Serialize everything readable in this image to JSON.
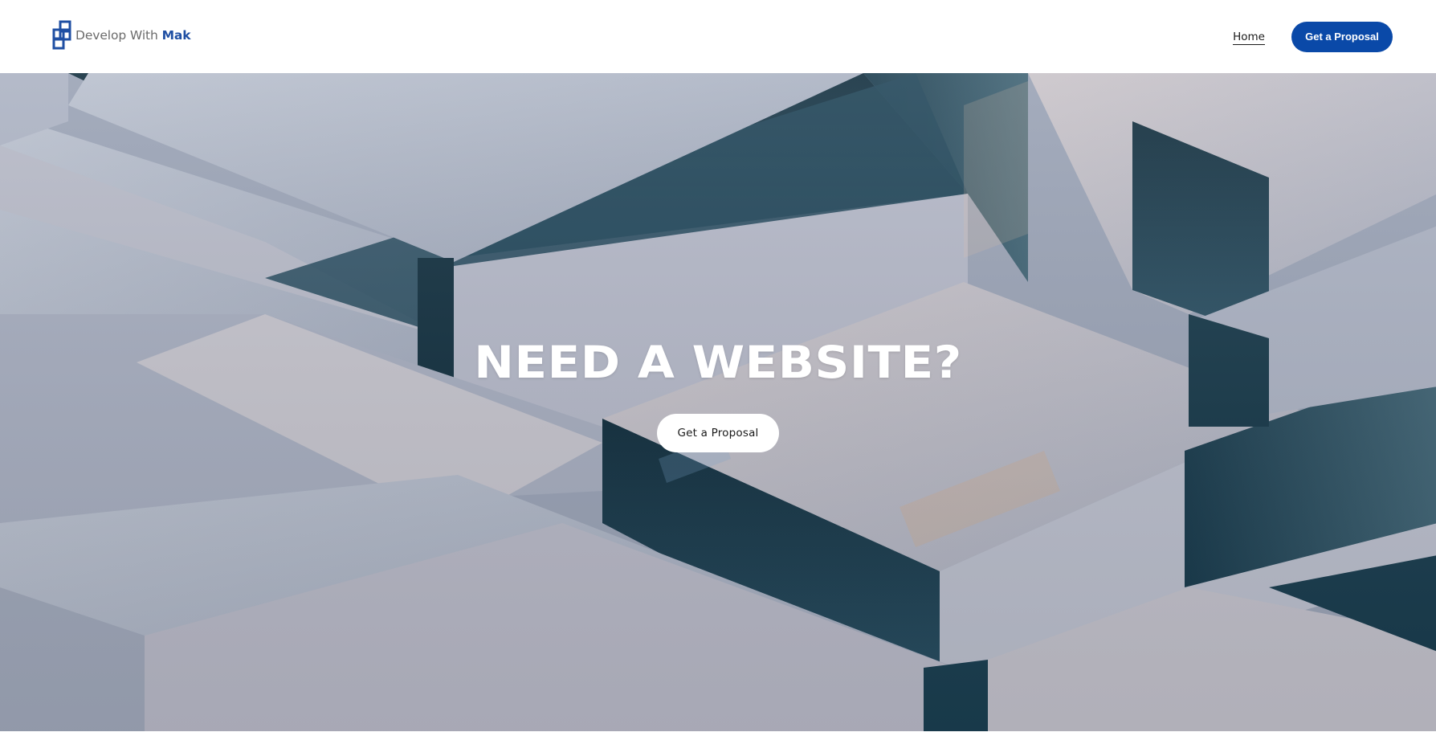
{
  "header": {
    "logo": {
      "icon": "stacked-squares-logo-icon",
      "text_main": "Develop With ",
      "text_accent": "Mak"
    },
    "nav": {
      "home_label": "Home",
      "cta_label": "Get a Proposal"
    }
  },
  "hero": {
    "background": "abstract-glass-cubes-image",
    "title": "NEED A WEBSITE?",
    "cta_label": "Get a Proposal"
  },
  "colors": {
    "brand_blue": "#0a49a8",
    "logo_accent": "#1f4fa3",
    "white": "#ffffff"
  }
}
